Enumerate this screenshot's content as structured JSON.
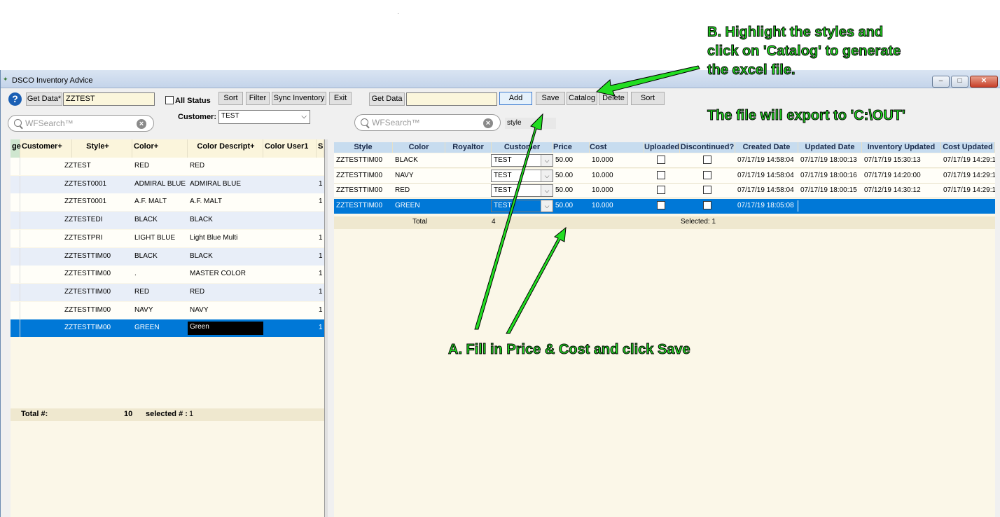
{
  "window": {
    "title": "DSCO Inventory Advice"
  },
  "left_toolbar": {
    "get_data": "Get Data*",
    "style_value": "ZZTEST",
    "all_status": "All Status",
    "sort": "Sort",
    "filter": "Filter",
    "sync_inventory": "Sync Inventory",
    "exit": "Exit",
    "customer_label": "Customer:",
    "customer_value": "TEST",
    "search_placeholder": "WFSearch™"
  },
  "right_toolbar": {
    "get_data": "Get Data",
    "input_value": "",
    "add": "Add",
    "save": "Save",
    "catalog": "Catalog",
    "delete": "Delete",
    "sort": "Sort",
    "search_placeholder": "WFSearch™",
    "search_field": "style"
  },
  "left_grid": {
    "columns": [
      "ge",
      "Customer+",
      "Style+",
      "Color+",
      "Color Descript+",
      "Color User1",
      "S"
    ],
    "rows": [
      {
        "style": "ZZTEST",
        "color": "RED",
        "desc": "RED",
        "s": ""
      },
      {
        "style": "ZZTEST0001",
        "color": "ADMIRAL BLUE",
        "desc": "ADMIRAL BLUE",
        "s": "1"
      },
      {
        "style": "ZZTEST0001",
        "color": "A.F. MALT",
        "desc": "A.F. MALT",
        "s": "1"
      },
      {
        "style": "ZZTESTEDI",
        "color": "BLACK",
        "desc": "BLACK",
        "s": ""
      },
      {
        "style": "ZZTESTPRI",
        "color": "LIGHT BLUE",
        "desc": "Light Blue Multi",
        "s": "1"
      },
      {
        "style": "ZZTESTTIM00",
        "color": "BLACK",
        "desc": "BLACK",
        "s": "1"
      },
      {
        "style": "ZZTESTTIM00",
        "color": ".",
        "desc": "MASTER COLOR",
        "s": "1"
      },
      {
        "style": "ZZTESTTIM00",
        "color": "RED",
        "desc": "RED",
        "s": "1"
      },
      {
        "style": "ZZTESTTIM00",
        "color": "NAVY",
        "desc": "NAVY",
        "s": "1"
      },
      {
        "style": "ZZTESTTIM00",
        "color": "GREEN",
        "desc": "Green",
        "s": "1"
      }
    ],
    "footer": {
      "total_label": "Total #:",
      "total_value": "10",
      "selected_label": "selected # :",
      "selected_value": "1"
    }
  },
  "right_grid": {
    "columns": [
      "Style",
      "Color",
      "Royaltor",
      "Customer",
      "Price",
      "Cost",
      "Uploaded",
      "Discontinued?",
      "Created Date",
      "Updated Date",
      "Inventory Updated",
      "Cost Updated"
    ],
    "rows": [
      {
        "style": "ZZTESTTIM00",
        "color": "BLACK",
        "customer": "TEST",
        "price": "50.00",
        "cost": "10.000",
        "created": "07/17/19 14:58:04",
        "updated": "07/17/19 18:00:13",
        "inv": "07/17/19 15:30:13",
        "costu": "07/17/19 14:29:1"
      },
      {
        "style": "ZZTESTTIM00",
        "color": "NAVY",
        "customer": "TEST",
        "price": "50.00",
        "cost": "10.000",
        "created": "07/17/19 14:58:04",
        "updated": "07/17/19 18:00:16",
        "inv": "07/17/19 14:20:00",
        "costu": "07/17/19 14:29:1"
      },
      {
        "style": "ZZTESTTIM00",
        "color": "RED",
        "customer": "TEST",
        "price": "50.00",
        "cost": "10.000",
        "created": "07/17/19 14:58:04",
        "updated": "07/17/19 18:00:15",
        "inv": "07/12/19 14:30:12",
        "costu": "07/17/19 14:29:1"
      },
      {
        "style": "ZZTESTTIM00",
        "color": "GREEN",
        "customer": "TEST",
        "price": "50.00",
        "cost": "10.000",
        "created": "07/17/19 18:05:08",
        "updated": "",
        "inv": "",
        "costu": ""
      }
    ],
    "footer": {
      "total_label": "Total",
      "total_value": "4",
      "selected": "Selected: 1"
    }
  },
  "annotations": {
    "b_text": "B.  Highlight the styles and\nclick on 'Catalog' to generate\nthe excel file.",
    "export_text": "The file will export to 'C:\\OUT'",
    "a_text": "A. Fill in Price & Cost  and click Save"
  },
  "colors": {
    "annotation_green": "#22dd22",
    "selection_blue": "#0078d7",
    "grid_bg": "#fbf7e8"
  }
}
